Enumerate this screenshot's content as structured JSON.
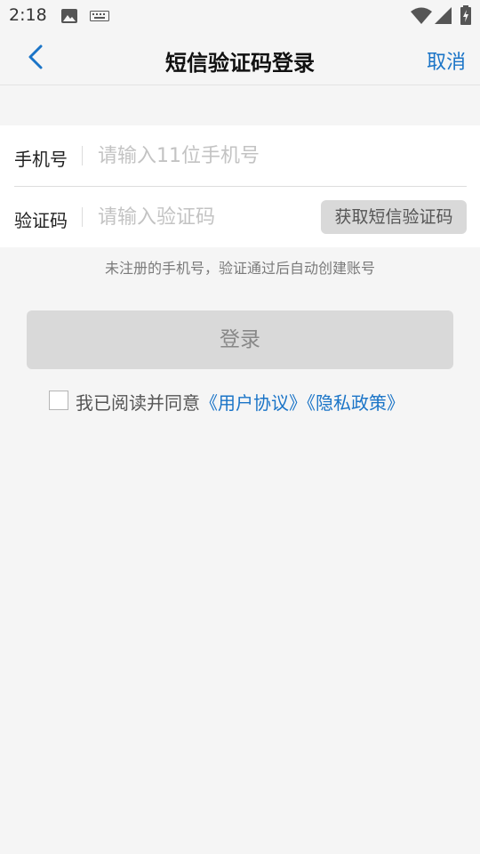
{
  "status_bar": {
    "time": "2:18",
    "icons": [
      "image-icon",
      "keyboard-icon",
      "wifi-icon",
      "signal-icon",
      "battery-icon"
    ]
  },
  "nav": {
    "back_icon": "chevron-left-icon",
    "title": "短信验证码登录",
    "cancel_label": "取消"
  },
  "form": {
    "phone": {
      "label": "手机号",
      "value": "",
      "placeholder": "请输入11位手机号"
    },
    "code": {
      "label": "验证码",
      "value": "",
      "placeholder": "请输入验证码",
      "send_button_label": "获取短信验证码"
    }
  },
  "hint": "未注册的手机号，验证通过后自动创建账号",
  "login_button_label": "登录",
  "agreement": {
    "checked": false,
    "prefix": "我已阅读并同意",
    "user_agreement_link": "《用户协议》",
    "privacy_policy_link": "《隐私政策》"
  },
  "colors": {
    "accent": "#1a74c7",
    "background": "#f5f5f5",
    "disabled_button": "#d9d9d9"
  }
}
